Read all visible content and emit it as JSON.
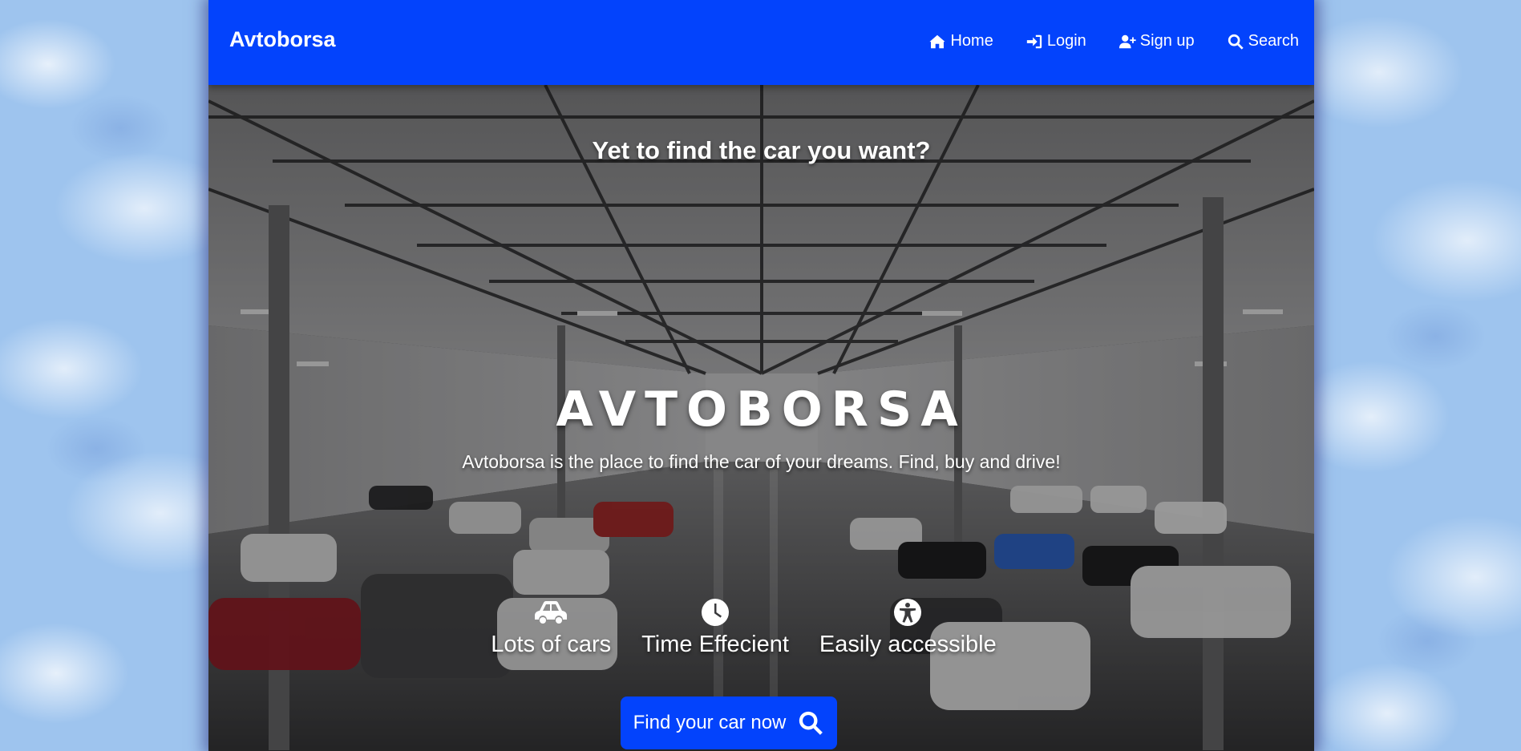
{
  "navbar": {
    "brand": "Avtoborsa",
    "links": [
      {
        "label": "Home",
        "icon": "home-icon"
      },
      {
        "label": "Login",
        "icon": "login-icon"
      },
      {
        "label": "Sign up",
        "icon": "user-plus-icon"
      },
      {
        "label": "Search",
        "icon": "search-icon"
      }
    ]
  },
  "hero": {
    "tagline": "Yet to find the car you want?",
    "title": "AVTOBORSA",
    "subtitle": "Avtoborsa is the place to find the car of your dreams. Find, buy and drive!",
    "features": [
      {
        "label": "Lots of cars",
        "icon": "car-icon"
      },
      {
        "label": "Time Effecient",
        "icon": "clock-icon"
      },
      {
        "label": "Easily accessible",
        "icon": "accessibility-icon"
      }
    ],
    "cta_label": "Find your car now"
  },
  "colors": {
    "brand_blue": "#0343fc",
    "text": "#ffffff"
  }
}
